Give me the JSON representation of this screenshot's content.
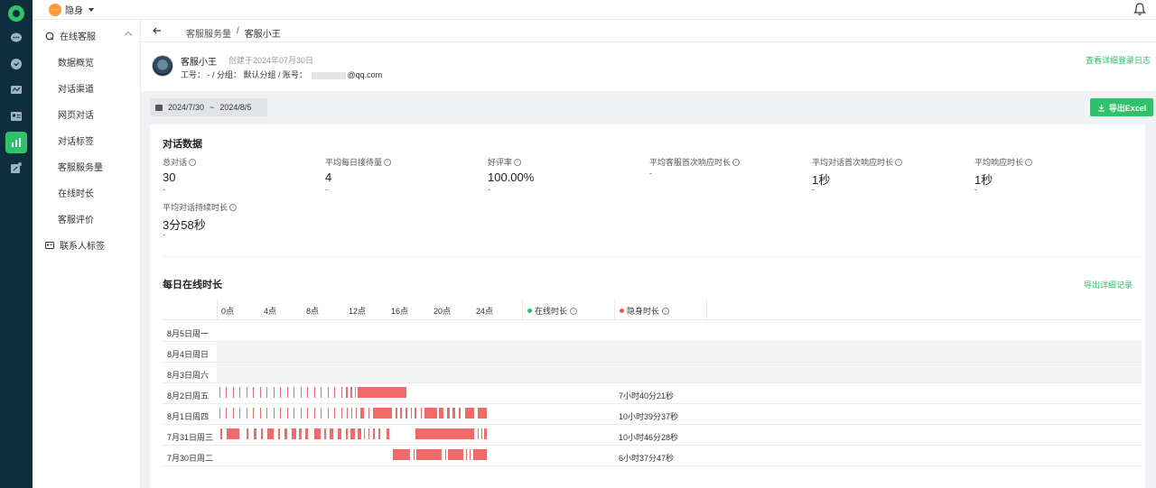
{
  "topbar": {
    "status": "隐身",
    "avatar_glyph": "···"
  },
  "nav_rail": {
    "active_color": "#2fc26a",
    "icons": [
      "logo-icon",
      "chat-icon",
      "message-icon",
      "monitor-icon",
      "contact-card-icon",
      "bar-chart-icon",
      "export-icon"
    ]
  },
  "sidebar": {
    "group_online": "在线客服",
    "items": [
      "数据概览",
      "对话渠道",
      "网页对话",
      "对话标签",
      "客服服务量",
      "在线时长",
      "客服评价"
    ],
    "group_contacts": "联系人标签"
  },
  "breadcrumb": {
    "parent": "客服服务量",
    "sep": "/",
    "current": "客服小王"
  },
  "profile": {
    "name": "客服小王",
    "created": "创建于2024年07月30日",
    "info_prefix": "工号： -  / 分组： 默认分组 / 账号： ",
    "email_suffix": "@qq.com",
    "log_link": "查看详细登录日志"
  },
  "toolbar": {
    "date_start": "2024/7/30",
    "date_sep": "~",
    "date_end": "2024/8/5",
    "export_label": "导出Excel"
  },
  "conversation": {
    "title": "对话数据",
    "metrics": [
      {
        "label": "总对话",
        "value": "30",
        "delta": "-"
      },
      {
        "label": "平均每日接待量",
        "value": "4",
        "delta": "-"
      },
      {
        "label": "好评率",
        "value": "100.00%",
        "delta": "-"
      },
      {
        "label": "平均客服首次响应时长",
        "value": "",
        "delta": "-"
      },
      {
        "label": "平均对话首次响应时长",
        "value": "1秒",
        "delta": "-"
      },
      {
        "label": "平均响应时长",
        "value": "1秒",
        "delta": "-"
      },
      {
        "label": "平均对话持续时长",
        "value": "3分58秒",
        "delta": "-"
      }
    ]
  },
  "online": {
    "title": "每日在线时长",
    "export_link": "导出详细记录",
    "hours": [
      "0点",
      "4点",
      "8点",
      "12点",
      "16点",
      "20点",
      "24点"
    ],
    "legend_online": "在线时长",
    "legend_stealth": "隐身时长",
    "online_color": "#2fc26a",
    "stealth_color": "#f05a5a",
    "rows": [
      {
        "label": "8月5日周一",
        "shaded": false,
        "duration": "",
        "segments": []
      },
      {
        "label": "8月4日周日",
        "shaded": true,
        "duration": "",
        "segments": []
      },
      {
        "label": "8月3日周六",
        "shaded": true,
        "duration": "",
        "segments": []
      },
      {
        "label": "8月2日周五",
        "shaded": false,
        "duration": "7小时40分21秒",
        "segments": [
          [
            0.2,
            0.3
          ],
          [
            0.8,
            0.9
          ],
          [
            1.4,
            1.5
          ],
          [
            2.0,
            2.1
          ],
          [
            2.6,
            2.7
          ],
          [
            3.2,
            3.3
          ],
          [
            3.8,
            3.9
          ],
          [
            4.4,
            4.5
          ],
          [
            5.0,
            5.1
          ],
          [
            5.6,
            5.7
          ],
          [
            6.2,
            6.3
          ],
          [
            6.8,
            6.9
          ],
          [
            7.4,
            7.5
          ],
          [
            8.0,
            8.1
          ],
          [
            8.6,
            8.7
          ],
          [
            9.2,
            9.3
          ],
          [
            9.8,
            9.9
          ],
          [
            10.4,
            10.5
          ],
          [
            11.0,
            11.1
          ],
          [
            11.4,
            11.6
          ],
          [
            11.8,
            12.0
          ],
          [
            12.2,
            12.3
          ],
          [
            12.5,
            16.8
          ]
        ]
      },
      {
        "label": "8月1日周四",
        "shaded": false,
        "duration": "10小时39分37秒",
        "segments": [
          [
            0.2,
            0.35
          ],
          [
            0.8,
            0.9
          ],
          [
            1.4,
            1.5
          ],
          [
            2.0,
            2.1
          ],
          [
            2.6,
            2.7
          ],
          [
            3.2,
            3.3
          ],
          [
            3.8,
            3.9
          ],
          [
            4.4,
            4.5
          ],
          [
            5.0,
            5.1
          ],
          [
            5.6,
            5.7
          ],
          [
            6.2,
            6.3
          ],
          [
            6.8,
            6.9
          ],
          [
            7.4,
            7.5
          ],
          [
            8.0,
            8.1
          ],
          [
            8.6,
            8.7
          ],
          [
            9.2,
            9.3
          ],
          [
            9.8,
            9.9
          ],
          [
            10.4,
            10.5
          ],
          [
            11.0,
            11.1
          ],
          [
            11.5,
            11.6
          ],
          [
            11.9,
            12.0
          ],
          [
            12.3,
            12.4
          ],
          [
            12.7,
            13.0
          ],
          [
            13.4,
            13.5
          ],
          [
            13.8,
            15.5
          ],
          [
            15.8,
            16.0
          ],
          [
            16.2,
            16.4
          ],
          [
            16.7,
            16.9
          ],
          [
            17.2,
            17.3
          ],
          [
            17.5,
            17.7
          ],
          [
            18.1,
            18.2
          ],
          [
            18.4,
            19.5
          ],
          [
            19.7,
            20.1
          ],
          [
            20.4,
            20.6
          ],
          [
            20.9,
            21.1
          ],
          [
            21.4,
            21.6
          ],
          [
            22.0,
            22.8
          ],
          [
            23.1,
            23.9
          ]
        ]
      },
      {
        "label": "7月31日周三",
        "shaded": false,
        "duration": "10小时46分28秒",
        "segments": [
          [
            0.3,
            0.5
          ],
          [
            0.9,
            2.0
          ],
          [
            2.6,
            2.8
          ],
          [
            3.3,
            3.5
          ],
          [
            3.9,
            4.1
          ],
          [
            4.5,
            5.0
          ],
          [
            5.4,
            5.6
          ],
          [
            6.0,
            6.2
          ],
          [
            6.6,
            7.0
          ],
          [
            7.3,
            7.5
          ],
          [
            7.8,
            8.1
          ],
          [
            8.6,
            9.2
          ],
          [
            9.5,
            9.7
          ],
          [
            10.0,
            10.3
          ],
          [
            10.7,
            11.0
          ],
          [
            11.4,
            11.6
          ],
          [
            11.8,
            12.2
          ],
          [
            12.5,
            12.8
          ],
          [
            13.0,
            13.1
          ],
          [
            13.4,
            13.5
          ],
          [
            13.8,
            14.0
          ],
          [
            14.3,
            14.5
          ],
          [
            15.0,
            15.3
          ],
          [
            17.6,
            22.8
          ],
          [
            23.1,
            23.2
          ],
          [
            23.4,
            23.5
          ],
          [
            23.7,
            23.9
          ]
        ]
      },
      {
        "label": "7月30日周二",
        "shaded": false,
        "duration": "6小时37分47秒",
        "segments": [
          [
            15.6,
            17.1
          ],
          [
            17.4,
            17.5
          ],
          [
            17.7,
            19.9
          ],
          [
            20.2,
            20.3
          ],
          [
            20.5,
            21.8
          ],
          [
            22.1,
            22.2
          ],
          [
            22.4,
            22.5
          ],
          [
            22.7,
            23.9
          ]
        ]
      }
    ]
  }
}
